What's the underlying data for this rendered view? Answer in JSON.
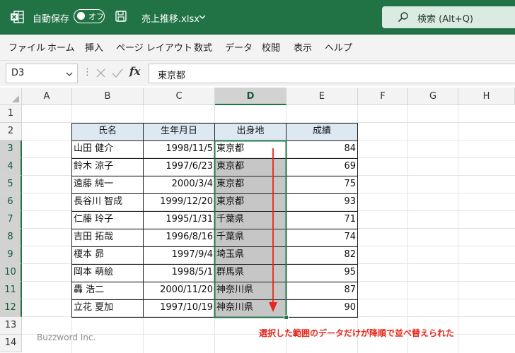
{
  "titlebar": {
    "autosave_label": "自動保存",
    "autosave_state": "オフ",
    "file_title": "売上推移.xlsx",
    "search_text": "検索 (Alt+Q)",
    "bg_color": "#217346"
  },
  "ribbon": {
    "tabs": [
      "ファイル",
      "ホーム",
      "挿入",
      "ページ レイアウト",
      "数式",
      "データ",
      "校閲",
      "表示",
      "ヘルプ"
    ]
  },
  "formula_bar": {
    "name_box": "D3",
    "formula": "東京都"
  },
  "sheet": {
    "columns": [
      "A",
      "B",
      "C",
      "D",
      "E",
      "F",
      "G",
      "H"
    ],
    "selected_column": "D",
    "rows": [
      "1",
      "2",
      "3",
      "4",
      "5",
      "6",
      "7",
      "8",
      "9",
      "10",
      "11",
      "12",
      "13",
      "14"
    ],
    "selected_range": "D3:D12",
    "table_headers": [
      "氏名",
      "生年月日",
      "出身地",
      "成績"
    ],
    "table_rows": [
      [
        "山田 健介",
        "1998/11/5",
        "東京都",
        "84"
      ],
      [
        "鈴木 涼子",
        "1997/6/23",
        "東京都",
        "69"
      ],
      [
        "遠藤 純一",
        "2000/3/4",
        "東京都",
        "75"
      ],
      [
        "長谷川 智成",
        "1999/12/20",
        "東京都",
        "93"
      ],
      [
        "仁藤 玲子",
        "1995/1/31",
        "千葉県",
        "71"
      ],
      [
        "吉田 拓哉",
        "1996/8/16",
        "千葉県",
        "74"
      ],
      [
        "榎本 昴",
        "1997/9/4",
        "埼玉県",
        "82"
      ],
      [
        "岡本 萌絵",
        "1998/5/1",
        "群馬県",
        "95"
      ],
      [
        "轟 浩二",
        "2000/11/20",
        "神奈川県",
        "87"
      ],
      [
        "立花 夏加",
        "1997/10/19",
        "神奈川県",
        "90"
      ]
    ]
  },
  "annotation": {
    "text": "選択した範囲のデータだけが降順で並べ替えられた",
    "color": "#e8261b"
  },
  "watermark": "Buzzword Inc."
}
